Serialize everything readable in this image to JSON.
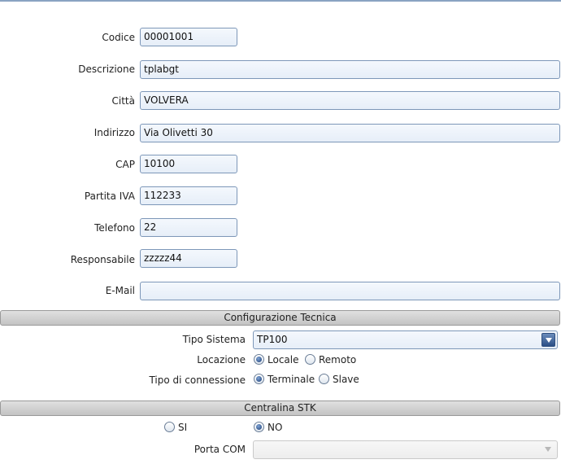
{
  "form": {
    "codice": {
      "label": "Codice",
      "value": "00001001"
    },
    "descrizione": {
      "label": "Descrizione",
      "value": "tplabgt"
    },
    "citta": {
      "label": "Città",
      "value": "VOLVERA"
    },
    "indirizzo": {
      "label": "Indirizzo",
      "value": "Via Olivetti 30"
    },
    "cap": {
      "label": "CAP",
      "value": "10100"
    },
    "partita_iva": {
      "label": "Partita IVA",
      "value": "112233"
    },
    "telefono": {
      "label": "Telefono",
      "value": "22"
    },
    "responsabile": {
      "label": "Responsabile",
      "value": "zzzzz44"
    },
    "email": {
      "label": "E-Mail",
      "value": ""
    }
  },
  "tech_config": {
    "title": "Configurazione Tecnica",
    "tipo_sistema": {
      "label": "Tipo Sistema",
      "value": "TP100"
    },
    "locazione": {
      "label": "Locazione",
      "options": [
        "Locale",
        "Remoto"
      ],
      "selected": "Locale"
    },
    "tipo_connessione": {
      "label": "Tipo di connessione",
      "options": [
        "Terminale",
        "Slave"
      ],
      "selected": "Terminale"
    }
  },
  "centralina": {
    "title": "Centralina STK",
    "options": [
      "SI",
      "NO"
    ],
    "selected": "NO",
    "porta_com": {
      "label": "Porta COM",
      "value": ""
    }
  },
  "colors": {
    "field_border": "#7d97b8",
    "section_bg": "#c3c3c3",
    "radio_selected": "#1f3f73"
  }
}
